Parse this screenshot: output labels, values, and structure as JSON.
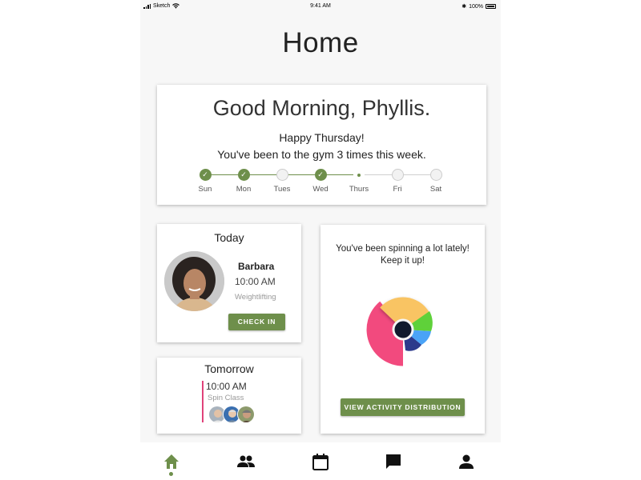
{
  "status_bar": {
    "carrier": "Sketch",
    "time": "9:41 AM",
    "battery": "100%"
  },
  "page": {
    "title": "Home"
  },
  "greeting": {
    "headline": "Good Morning, Phyllis.",
    "line1": "Happy Thursday!",
    "line2": "You've been to the gym 3 times this week."
  },
  "week": [
    {
      "label": "Sun",
      "state": "done"
    },
    {
      "label": "Mon",
      "state": "done"
    },
    {
      "label": "Tues",
      "state": "empty"
    },
    {
      "label": "Wed",
      "state": "done"
    },
    {
      "label": "Thurs",
      "state": "today"
    },
    {
      "label": "Fri",
      "state": "empty"
    },
    {
      "label": "Sat",
      "state": "empty"
    }
  ],
  "today": {
    "title": "Today",
    "trainer": "Barbara",
    "time": "10:00 AM",
    "activity": "Weightlifting",
    "button": "CHECK IN"
  },
  "tomorrow": {
    "title": "Tomorrow",
    "time": "10:00 AM",
    "activity": "Spin Class"
  },
  "activity_card": {
    "message_line1": "You've been spinning a lot lately!",
    "message_line2": "Keep it up!",
    "button": "VIEW ACTIVITY DISTRIBUTION"
  },
  "tabs": [
    {
      "icon": "home-icon",
      "active": true
    },
    {
      "icon": "people-icon",
      "active": false
    },
    {
      "icon": "calendar-icon",
      "active": false
    },
    {
      "icon": "chat-icon",
      "active": false
    },
    {
      "icon": "profile-icon",
      "active": false
    }
  ],
  "colors": {
    "accent": "#6e8f4b",
    "pink": "#f24a7e",
    "yellow": "#f9c463",
    "green": "#5fd13a",
    "blue": "#4aa3f7",
    "navy": "#2c3a8c"
  }
}
